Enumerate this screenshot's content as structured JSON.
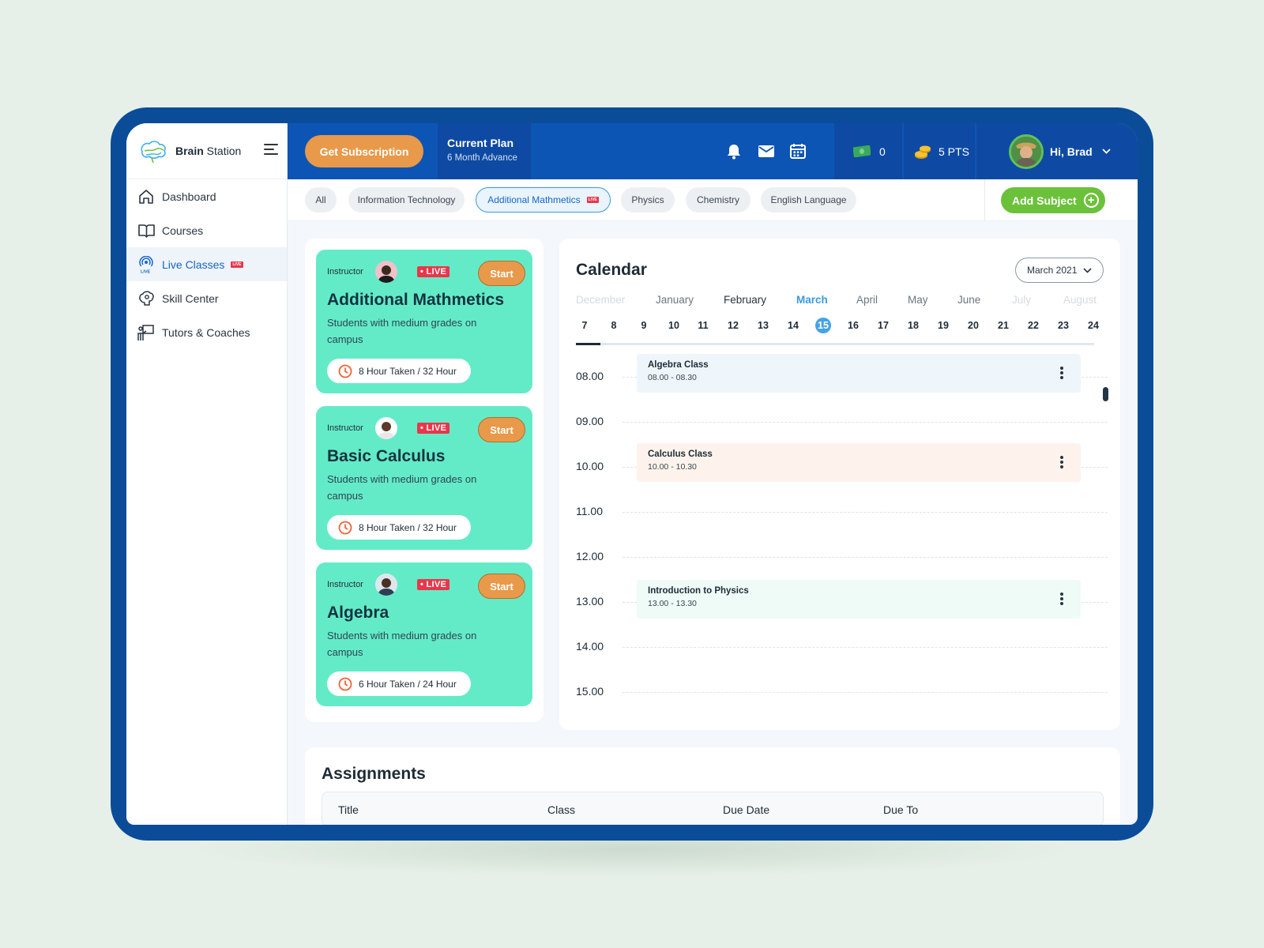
{
  "brand": {
    "name_bold": "Brain",
    "name_rest": " Station"
  },
  "sidebar": {
    "items": [
      {
        "label": "Dashboard",
        "icon": "home-icon"
      },
      {
        "label": "Courses",
        "icon": "book-icon"
      },
      {
        "label": "Live Classes",
        "icon": "live-broadcast-icon",
        "badge": "LIVE",
        "active": true
      },
      {
        "label": "Skill Center",
        "icon": "brain-gear-icon"
      },
      {
        "label": "Tutors & Coaches",
        "icon": "tutor-board-icon"
      }
    ]
  },
  "topbar": {
    "subscribe_label": "Get Subscription",
    "plan_title": "Current Plan",
    "plan_detail": "6 Month Advance",
    "cash_count": "0",
    "points": "5 PTS",
    "greeting": "Hi, Brad"
  },
  "filters": {
    "chips": [
      "All",
      "Information Technology",
      "Additional Mathmetics",
      "Physics",
      "Chemistry",
      "English Language"
    ],
    "active_badge": "LIVE",
    "add_label": "Add Subject"
  },
  "live_classes": [
    {
      "instructor_label": "Instructor",
      "live": "• LIVE",
      "start": "Start",
      "title": "Additional Mathmetics",
      "desc": "Students with medium grades on campus",
      "hours": "8 Hour Taken / 32 Hour"
    },
    {
      "instructor_label": "Instructor",
      "live": "• LIVE",
      "start": "Start",
      "title": "Basic Calculus",
      "desc": "Students with medium grades on campus",
      "hours": "8 Hour Taken / 32 Hour"
    },
    {
      "instructor_label": "Instructor",
      "live": "• LIVE",
      "start": "Start",
      "title": "Algebra",
      "desc": "Students with medium grades on campus",
      "hours": "6 Hour Taken / 24 Hour"
    }
  ],
  "calendar": {
    "title": "Calendar",
    "month_select": "March 2021",
    "months": [
      "December",
      "January",
      "February",
      "March",
      "April",
      "May",
      "June",
      "July",
      "August"
    ],
    "current_month": "March",
    "days": [
      "7",
      "8",
      "9",
      "10",
      "11",
      "12",
      "13",
      "14",
      "15",
      "16",
      "17",
      "18",
      "19",
      "20",
      "21",
      "22",
      "23",
      "24"
    ],
    "current_day": "15",
    "hours": [
      "08.00",
      "09.00",
      "10.00",
      "11.00",
      "12.00",
      "13.00",
      "14.00",
      "15.00"
    ],
    "events": [
      {
        "name": "Algebra Class",
        "time": "08.00 - 08.30",
        "color": "#eef6fc"
      },
      {
        "name": "Calculus Class",
        "time": "10.00 - 10.30",
        "color": "#fdf3ec"
      },
      {
        "name": "Introduction to Physics",
        "time": "13.00 - 13.30",
        "color": "#eefbf6"
      }
    ]
  },
  "assignments": {
    "title": "Assignments",
    "columns": [
      "Title",
      "Class",
      "Due Date",
      "Due To"
    ]
  },
  "colors": {
    "brand_blue": "#0d55b5",
    "accent_orange": "#e8994a",
    "card_mint": "#63ebc8",
    "add_green": "#6cc13b",
    "live_red": "#e9364a"
  }
}
